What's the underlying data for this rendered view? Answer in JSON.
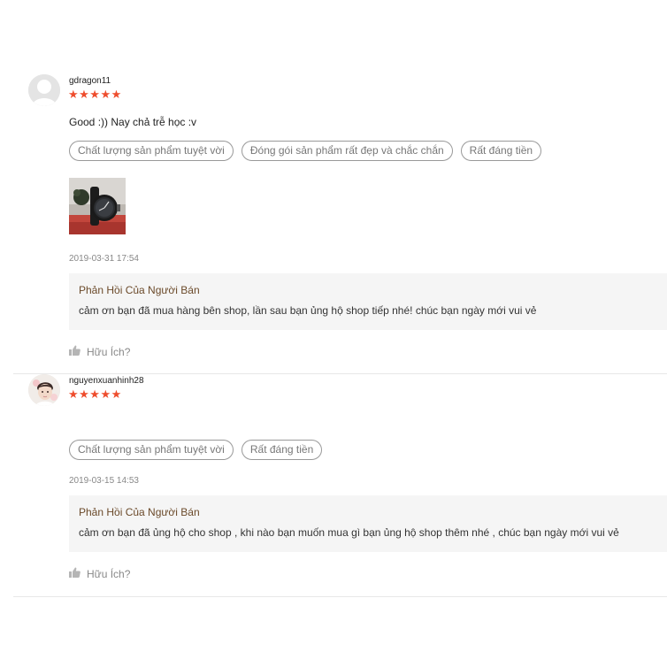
{
  "reviews": [
    {
      "username": "gdragon11",
      "stars": "★★★★★",
      "rating": 5,
      "comment": "Good :)) Nay chả trễ học :v",
      "tags": [
        "Chất lượng sản phẩm tuyệt vời",
        "Đóng gói sản phẩm rất đẹp và chắc chắn",
        "Rất đáng tiền"
      ],
      "time": "2019-03-31 17:54",
      "reply_title": "Phản Hồi Của Người Bán",
      "reply_text": "cảm ơn bạn đã mua hàng bên shop, lần sau bạn ủng hộ shop tiếp nhé! chúc bạn ngày mới vui vẻ",
      "helpful": "Hữu Ích?"
    },
    {
      "username": "nguyenxuanhinh28",
      "stars": "★★★★★",
      "rating": 5,
      "comment": "",
      "tags": [
        "Chất lượng sản phẩm tuyệt vời",
        "Rất đáng tiền"
      ],
      "time": "2019-03-15 14:53",
      "reply_title": "Phản Hồi Của Người Bán",
      "reply_text": "cảm ơn bạn đã ủng hộ cho shop , khi nào bạn muốn mua gì bạn ủng hộ shop thêm nhé , chúc bạn ngày mới vui vẻ",
      "helpful": "Hữu Ích?"
    }
  ],
  "colors": {
    "star": "#ee4d2d",
    "reply_title": "#6b4a2a",
    "reply_bg": "#f5f5f5"
  },
  "icons": {
    "avatar_default": "user-silhouette-icon",
    "helpful": "thumbs-up-icon"
  }
}
